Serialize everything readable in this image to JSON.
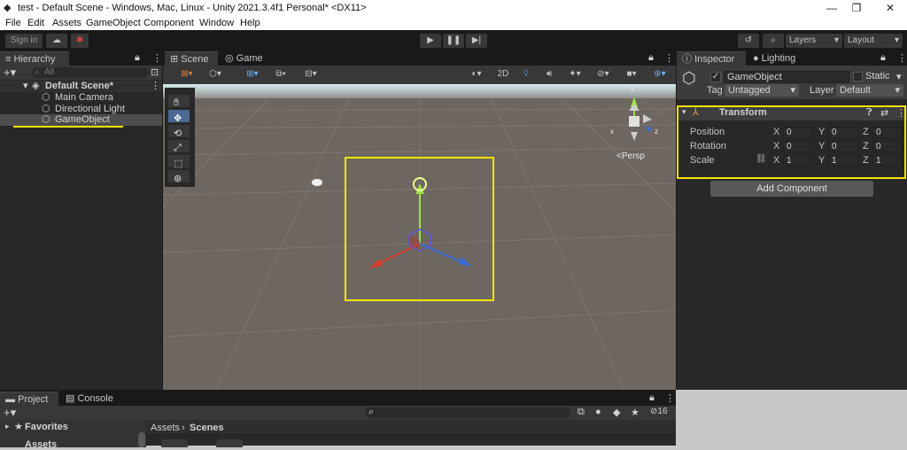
{
  "window": {
    "title": "test - Default Scene - Windows, Mac, Linux - Unity 2021.3.4f1 Personal* <DX11>"
  },
  "menu": [
    "File",
    "Edit",
    "Assets",
    "GameObject",
    "Component",
    "Window",
    "Help"
  ],
  "toolbar": {
    "sign_in": "Sign in",
    "layers": "Layers",
    "layout": "Layout"
  },
  "hierarchy": {
    "tab": "Hierarchy",
    "search_placeholder": "All",
    "scene": "Default Scene*",
    "items": [
      "Main Camera",
      "Directional Light",
      "GameObject"
    ]
  },
  "scene_view": {
    "tabs": [
      "Scene",
      "Game"
    ],
    "mode_2d": "2D",
    "persp": "<Persp",
    "gizmo": {
      "x": "x",
      "y": "y",
      "z": "z"
    }
  },
  "inspector": {
    "tabs": [
      "Inspector",
      "Lighting"
    ],
    "object_name": "GameObject",
    "static_label": "Static",
    "tag_label": "Tag",
    "tag_value": "Untagged",
    "layer_label": "Layer",
    "layer_value": "Default",
    "component": "Transform",
    "rows": [
      {
        "label": "Position",
        "x": "0",
        "y": "0",
        "z": "0"
      },
      {
        "label": "Rotation",
        "x": "0",
        "y": "0",
        "z": "0"
      },
      {
        "label": "Scale",
        "x": "1",
        "y": "1",
        "z": "1"
      }
    ],
    "axis": {
      "x": "X",
      "y": "Y",
      "z": "Z"
    },
    "add_component": "Add Component"
  },
  "project": {
    "tabs": [
      "Project",
      "Console"
    ],
    "favorites": "Favorites",
    "breadcrumb_assets": "Assets",
    "breadcrumb_sep": "›",
    "breadcrumb_scenes": "Scenes",
    "hidden_count": "16",
    "assets_root": "Assets"
  },
  "colors": {
    "highlight": "#f2e400",
    "editor_dark": "#191919",
    "panel": "#282828",
    "selection": "#4d4d4d"
  }
}
